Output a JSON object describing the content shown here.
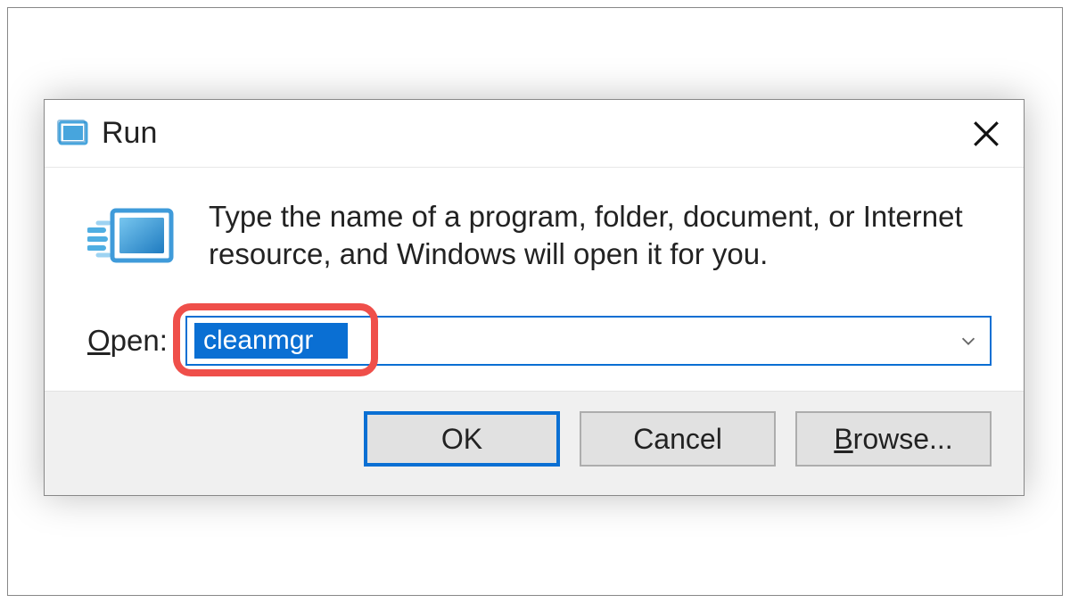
{
  "dialog": {
    "title": "Run",
    "description": "Type the name of a program, folder, document, or Internet resource, and Windows will open it for you.",
    "open_label_prefix": "O",
    "open_label_rest": "pen:",
    "input_value": "cleanmgr",
    "buttons": {
      "ok": "OK",
      "cancel": "Cancel",
      "browse_prefix": "B",
      "browse_rest": "rowse..."
    }
  }
}
